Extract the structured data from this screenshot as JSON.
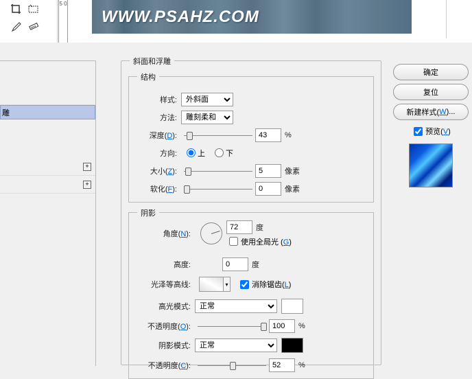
{
  "banner_text": "WWW.PSAHZ.COM",
  "ruler_mark": "5\n0",
  "layers": {
    "selected_suffix": "雕"
  },
  "dialog": {
    "title": "斜面和浮雕",
    "structure": {
      "legend": "结构",
      "style": {
        "label": "样式:",
        "value": "外斜面"
      },
      "method": {
        "label": "方法:",
        "value": "雕刻柔和"
      },
      "depth": {
        "label_pre": "深度(",
        "hotkey": "D",
        "label_post": "):",
        "value": "43",
        "unit": "%"
      },
      "direction": {
        "label": "方向:",
        "up": "上",
        "down": "下"
      },
      "size": {
        "label_pre": "大小(",
        "hotkey": "Z",
        "label_post": "):",
        "value": "5",
        "unit": "像素"
      },
      "soften": {
        "label_pre": "软化(",
        "hotkey": "F",
        "label_post": "):",
        "value": "0",
        "unit": "像素"
      }
    },
    "shadow": {
      "legend": "阴影",
      "angle": {
        "label_pre": "角度(",
        "hotkey": "N",
        "label_post": "):",
        "value": "72",
        "unit": "度"
      },
      "global": {
        "label_pre": "使用全局光 (",
        "hotkey": "G",
        "label_post": ")"
      },
      "altitude": {
        "label": "高度:",
        "value": "0",
        "unit": "度"
      },
      "contour": {
        "label": "光泽等高线:"
      },
      "antialias": {
        "label_pre": "消除锯齿(",
        "hotkey": "L",
        "label_post": ")"
      },
      "highlight_mode": {
        "label": "高光模式:",
        "value": "正常"
      },
      "highlight_opacity": {
        "label_pre": "不透明度(",
        "hotkey": "O",
        "label_post": "):",
        "value": "100",
        "unit": "%"
      },
      "shadow_mode": {
        "label": "阴影模式:",
        "value": "正常"
      },
      "shadow_opacity": {
        "label_pre": "不透明度(",
        "hotkey": "C",
        "label_post": "):",
        "value": "52",
        "unit": "%"
      }
    }
  },
  "buttons": {
    "ok": "确定",
    "reset": "复位",
    "new_style_pre": "新建样式(",
    "new_style_hot": "W",
    "new_style_post": ")...",
    "preview_pre": "预览(",
    "preview_hot": "V",
    "preview_post": ")"
  }
}
